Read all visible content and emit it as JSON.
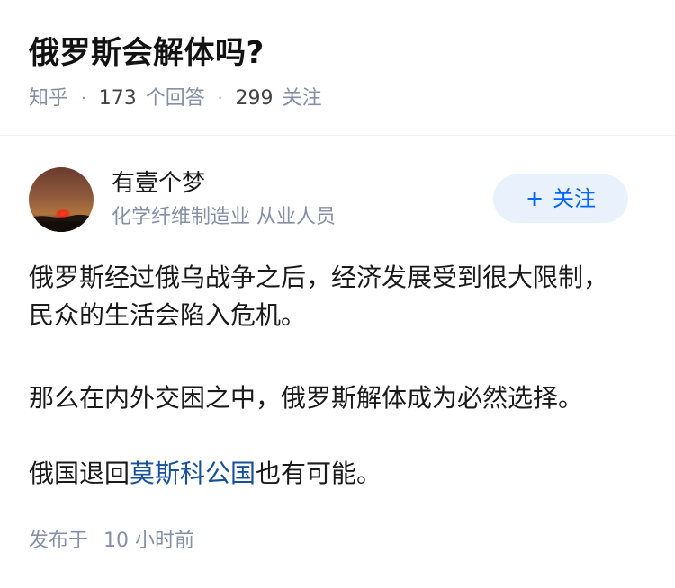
{
  "question": {
    "title": "俄罗斯会解体吗?",
    "source": "知乎",
    "answer_count": "173",
    "answer_label": "个回答",
    "follower_count": "299",
    "follower_label": "关注",
    "separator": "·"
  },
  "author": {
    "name": "有壹个梦",
    "bio": "化学纤维制造业 从业人员",
    "follow_plus": "+",
    "follow_label": "关注"
  },
  "answer": {
    "paragraph1": "俄罗斯经过俄乌战争之后，经济发展受到很大限制，民众的生活会陷入危机。",
    "paragraph2": "那么在内外交困之中，俄罗斯解体成为必然选择。",
    "paragraph3_prefix": "俄国退回",
    "paragraph3_link": "莫斯科公国",
    "paragraph3_suffix": "也有可能。"
  },
  "footer": {
    "published_label": "发布于",
    "published_time": "10 小时前"
  },
  "colors": {
    "accent": "#0066ff",
    "link": "#175199",
    "meta_gray": "#8590a6",
    "follow_bg": "#e9f2fc"
  }
}
